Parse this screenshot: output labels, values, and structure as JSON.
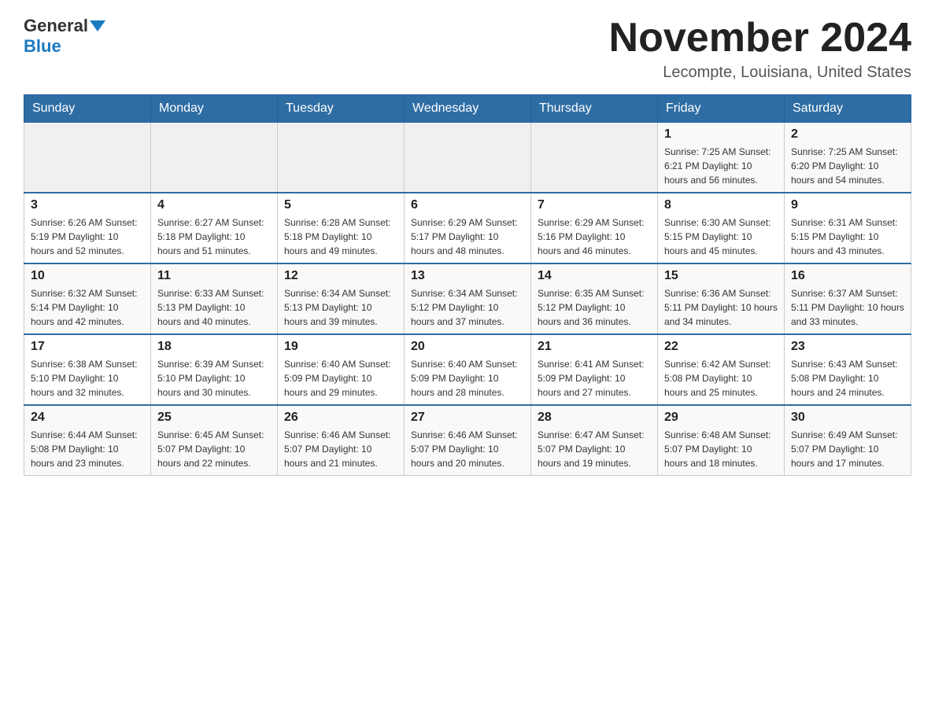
{
  "header": {
    "logo_general": "General",
    "logo_blue": "Blue",
    "month_title": "November 2024",
    "location": "Lecompte, Louisiana, United States"
  },
  "days_of_week": [
    "Sunday",
    "Monday",
    "Tuesday",
    "Wednesday",
    "Thursday",
    "Friday",
    "Saturday"
  ],
  "weeks": [
    {
      "days": [
        {
          "number": "",
          "info": ""
        },
        {
          "number": "",
          "info": ""
        },
        {
          "number": "",
          "info": ""
        },
        {
          "number": "",
          "info": ""
        },
        {
          "number": "",
          "info": ""
        },
        {
          "number": "1",
          "info": "Sunrise: 7:25 AM\nSunset: 6:21 PM\nDaylight: 10 hours\nand 56 minutes."
        },
        {
          "number": "2",
          "info": "Sunrise: 7:25 AM\nSunset: 6:20 PM\nDaylight: 10 hours\nand 54 minutes."
        }
      ]
    },
    {
      "days": [
        {
          "number": "3",
          "info": "Sunrise: 6:26 AM\nSunset: 5:19 PM\nDaylight: 10 hours\nand 52 minutes."
        },
        {
          "number": "4",
          "info": "Sunrise: 6:27 AM\nSunset: 5:18 PM\nDaylight: 10 hours\nand 51 minutes."
        },
        {
          "number": "5",
          "info": "Sunrise: 6:28 AM\nSunset: 5:18 PM\nDaylight: 10 hours\nand 49 minutes."
        },
        {
          "number": "6",
          "info": "Sunrise: 6:29 AM\nSunset: 5:17 PM\nDaylight: 10 hours\nand 48 minutes."
        },
        {
          "number": "7",
          "info": "Sunrise: 6:29 AM\nSunset: 5:16 PM\nDaylight: 10 hours\nand 46 minutes."
        },
        {
          "number": "8",
          "info": "Sunrise: 6:30 AM\nSunset: 5:15 PM\nDaylight: 10 hours\nand 45 minutes."
        },
        {
          "number": "9",
          "info": "Sunrise: 6:31 AM\nSunset: 5:15 PM\nDaylight: 10 hours\nand 43 minutes."
        }
      ]
    },
    {
      "days": [
        {
          "number": "10",
          "info": "Sunrise: 6:32 AM\nSunset: 5:14 PM\nDaylight: 10 hours\nand 42 minutes."
        },
        {
          "number": "11",
          "info": "Sunrise: 6:33 AM\nSunset: 5:13 PM\nDaylight: 10 hours\nand 40 minutes."
        },
        {
          "number": "12",
          "info": "Sunrise: 6:34 AM\nSunset: 5:13 PM\nDaylight: 10 hours\nand 39 minutes."
        },
        {
          "number": "13",
          "info": "Sunrise: 6:34 AM\nSunset: 5:12 PM\nDaylight: 10 hours\nand 37 minutes."
        },
        {
          "number": "14",
          "info": "Sunrise: 6:35 AM\nSunset: 5:12 PM\nDaylight: 10 hours\nand 36 minutes."
        },
        {
          "number": "15",
          "info": "Sunrise: 6:36 AM\nSunset: 5:11 PM\nDaylight: 10 hours\nand 34 minutes."
        },
        {
          "number": "16",
          "info": "Sunrise: 6:37 AM\nSunset: 5:11 PM\nDaylight: 10 hours\nand 33 minutes."
        }
      ]
    },
    {
      "days": [
        {
          "number": "17",
          "info": "Sunrise: 6:38 AM\nSunset: 5:10 PM\nDaylight: 10 hours\nand 32 minutes."
        },
        {
          "number": "18",
          "info": "Sunrise: 6:39 AM\nSunset: 5:10 PM\nDaylight: 10 hours\nand 30 minutes."
        },
        {
          "number": "19",
          "info": "Sunrise: 6:40 AM\nSunset: 5:09 PM\nDaylight: 10 hours\nand 29 minutes."
        },
        {
          "number": "20",
          "info": "Sunrise: 6:40 AM\nSunset: 5:09 PM\nDaylight: 10 hours\nand 28 minutes."
        },
        {
          "number": "21",
          "info": "Sunrise: 6:41 AM\nSunset: 5:09 PM\nDaylight: 10 hours\nand 27 minutes."
        },
        {
          "number": "22",
          "info": "Sunrise: 6:42 AM\nSunset: 5:08 PM\nDaylight: 10 hours\nand 25 minutes."
        },
        {
          "number": "23",
          "info": "Sunrise: 6:43 AM\nSunset: 5:08 PM\nDaylight: 10 hours\nand 24 minutes."
        }
      ]
    },
    {
      "days": [
        {
          "number": "24",
          "info": "Sunrise: 6:44 AM\nSunset: 5:08 PM\nDaylight: 10 hours\nand 23 minutes."
        },
        {
          "number": "25",
          "info": "Sunrise: 6:45 AM\nSunset: 5:07 PM\nDaylight: 10 hours\nand 22 minutes."
        },
        {
          "number": "26",
          "info": "Sunrise: 6:46 AM\nSunset: 5:07 PM\nDaylight: 10 hours\nand 21 minutes."
        },
        {
          "number": "27",
          "info": "Sunrise: 6:46 AM\nSunset: 5:07 PM\nDaylight: 10 hours\nand 20 minutes."
        },
        {
          "number": "28",
          "info": "Sunrise: 6:47 AM\nSunset: 5:07 PM\nDaylight: 10 hours\nand 19 minutes."
        },
        {
          "number": "29",
          "info": "Sunrise: 6:48 AM\nSunset: 5:07 PM\nDaylight: 10 hours\nand 18 minutes."
        },
        {
          "number": "30",
          "info": "Sunrise: 6:49 AM\nSunset: 5:07 PM\nDaylight: 10 hours\nand 17 minutes."
        }
      ]
    }
  ]
}
